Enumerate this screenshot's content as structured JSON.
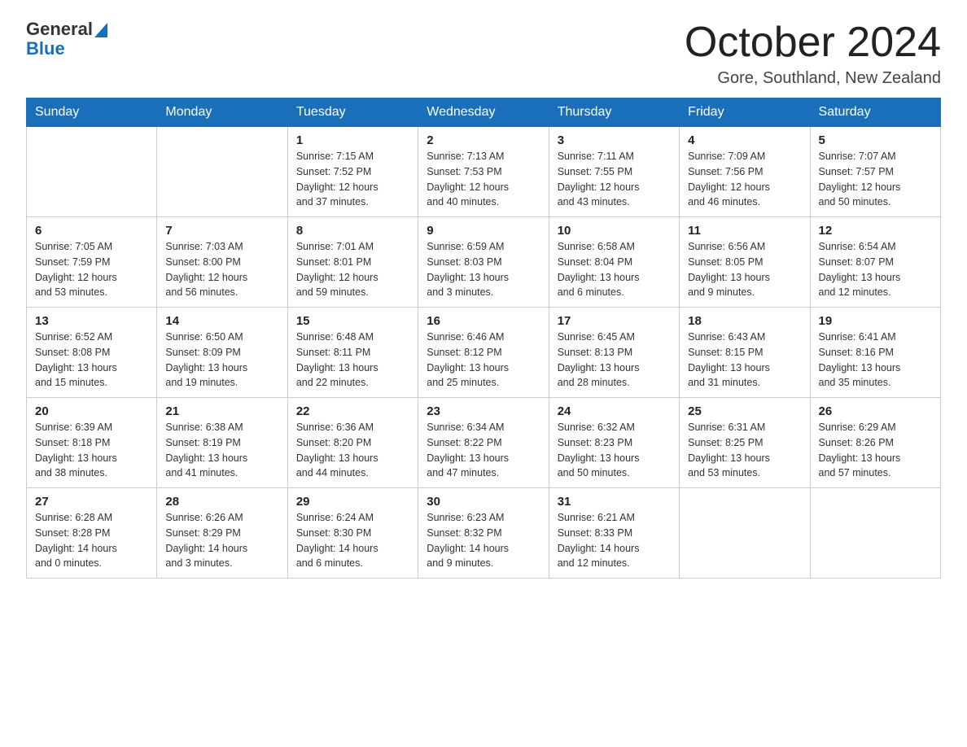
{
  "logo": {
    "general": "General",
    "blue": "Blue"
  },
  "title": "October 2024",
  "location": "Gore, Southland, New Zealand",
  "weekdays": [
    "Sunday",
    "Monday",
    "Tuesday",
    "Wednesday",
    "Thursday",
    "Friday",
    "Saturday"
  ],
  "weeks": [
    [
      {
        "day": "",
        "info": ""
      },
      {
        "day": "",
        "info": ""
      },
      {
        "day": "1",
        "info": "Sunrise: 7:15 AM\nSunset: 7:52 PM\nDaylight: 12 hours\nand 37 minutes."
      },
      {
        "day": "2",
        "info": "Sunrise: 7:13 AM\nSunset: 7:53 PM\nDaylight: 12 hours\nand 40 minutes."
      },
      {
        "day": "3",
        "info": "Sunrise: 7:11 AM\nSunset: 7:55 PM\nDaylight: 12 hours\nand 43 minutes."
      },
      {
        "day": "4",
        "info": "Sunrise: 7:09 AM\nSunset: 7:56 PM\nDaylight: 12 hours\nand 46 minutes."
      },
      {
        "day": "5",
        "info": "Sunrise: 7:07 AM\nSunset: 7:57 PM\nDaylight: 12 hours\nand 50 minutes."
      }
    ],
    [
      {
        "day": "6",
        "info": "Sunrise: 7:05 AM\nSunset: 7:59 PM\nDaylight: 12 hours\nand 53 minutes."
      },
      {
        "day": "7",
        "info": "Sunrise: 7:03 AM\nSunset: 8:00 PM\nDaylight: 12 hours\nand 56 minutes."
      },
      {
        "day": "8",
        "info": "Sunrise: 7:01 AM\nSunset: 8:01 PM\nDaylight: 12 hours\nand 59 minutes."
      },
      {
        "day": "9",
        "info": "Sunrise: 6:59 AM\nSunset: 8:03 PM\nDaylight: 13 hours\nand 3 minutes."
      },
      {
        "day": "10",
        "info": "Sunrise: 6:58 AM\nSunset: 8:04 PM\nDaylight: 13 hours\nand 6 minutes."
      },
      {
        "day": "11",
        "info": "Sunrise: 6:56 AM\nSunset: 8:05 PM\nDaylight: 13 hours\nand 9 minutes."
      },
      {
        "day": "12",
        "info": "Sunrise: 6:54 AM\nSunset: 8:07 PM\nDaylight: 13 hours\nand 12 minutes."
      }
    ],
    [
      {
        "day": "13",
        "info": "Sunrise: 6:52 AM\nSunset: 8:08 PM\nDaylight: 13 hours\nand 15 minutes."
      },
      {
        "day": "14",
        "info": "Sunrise: 6:50 AM\nSunset: 8:09 PM\nDaylight: 13 hours\nand 19 minutes."
      },
      {
        "day": "15",
        "info": "Sunrise: 6:48 AM\nSunset: 8:11 PM\nDaylight: 13 hours\nand 22 minutes."
      },
      {
        "day": "16",
        "info": "Sunrise: 6:46 AM\nSunset: 8:12 PM\nDaylight: 13 hours\nand 25 minutes."
      },
      {
        "day": "17",
        "info": "Sunrise: 6:45 AM\nSunset: 8:13 PM\nDaylight: 13 hours\nand 28 minutes."
      },
      {
        "day": "18",
        "info": "Sunrise: 6:43 AM\nSunset: 8:15 PM\nDaylight: 13 hours\nand 31 minutes."
      },
      {
        "day": "19",
        "info": "Sunrise: 6:41 AM\nSunset: 8:16 PM\nDaylight: 13 hours\nand 35 minutes."
      }
    ],
    [
      {
        "day": "20",
        "info": "Sunrise: 6:39 AM\nSunset: 8:18 PM\nDaylight: 13 hours\nand 38 minutes."
      },
      {
        "day": "21",
        "info": "Sunrise: 6:38 AM\nSunset: 8:19 PM\nDaylight: 13 hours\nand 41 minutes."
      },
      {
        "day": "22",
        "info": "Sunrise: 6:36 AM\nSunset: 8:20 PM\nDaylight: 13 hours\nand 44 minutes."
      },
      {
        "day": "23",
        "info": "Sunrise: 6:34 AM\nSunset: 8:22 PM\nDaylight: 13 hours\nand 47 minutes."
      },
      {
        "day": "24",
        "info": "Sunrise: 6:32 AM\nSunset: 8:23 PM\nDaylight: 13 hours\nand 50 minutes."
      },
      {
        "day": "25",
        "info": "Sunrise: 6:31 AM\nSunset: 8:25 PM\nDaylight: 13 hours\nand 53 minutes."
      },
      {
        "day": "26",
        "info": "Sunrise: 6:29 AM\nSunset: 8:26 PM\nDaylight: 13 hours\nand 57 minutes."
      }
    ],
    [
      {
        "day": "27",
        "info": "Sunrise: 6:28 AM\nSunset: 8:28 PM\nDaylight: 14 hours\nand 0 minutes."
      },
      {
        "day": "28",
        "info": "Sunrise: 6:26 AM\nSunset: 8:29 PM\nDaylight: 14 hours\nand 3 minutes."
      },
      {
        "day": "29",
        "info": "Sunrise: 6:24 AM\nSunset: 8:30 PM\nDaylight: 14 hours\nand 6 minutes."
      },
      {
        "day": "30",
        "info": "Sunrise: 6:23 AM\nSunset: 8:32 PM\nDaylight: 14 hours\nand 9 minutes."
      },
      {
        "day": "31",
        "info": "Sunrise: 6:21 AM\nSunset: 8:33 PM\nDaylight: 14 hours\nand 12 minutes."
      },
      {
        "day": "",
        "info": ""
      },
      {
        "day": "",
        "info": ""
      }
    ]
  ]
}
